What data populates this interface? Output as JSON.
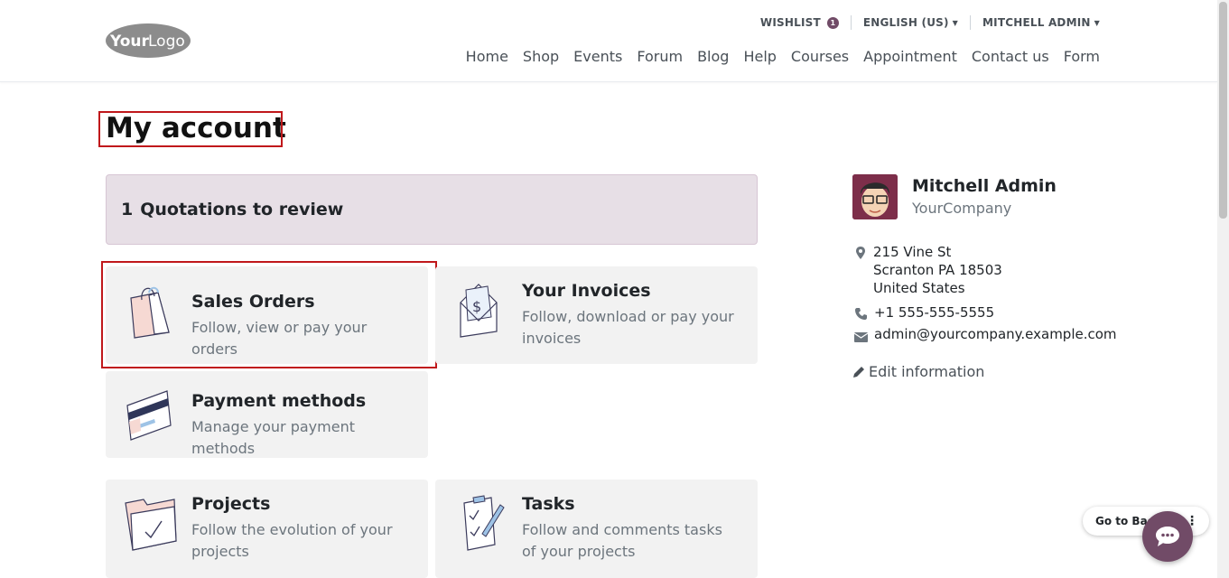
{
  "header": {
    "logo_alt": "Your Logo",
    "wishlist_label": "WISHLIST",
    "wishlist_count": "1",
    "language_label": "ENGLISH (US)",
    "user_label": "MITCHELL ADMIN",
    "nav": [
      "Home",
      "Shop",
      "Events",
      "Forum",
      "Blog",
      "Help",
      "Courses",
      "Appointment",
      "Contact us",
      "Form"
    ]
  },
  "page": {
    "title": "My account",
    "alert": {
      "count": "1",
      "label": "Quotations to review"
    }
  },
  "cards": {
    "sales_orders": {
      "title": "Sales Orders",
      "desc": "Follow, view or pay your orders"
    },
    "invoices": {
      "title": "Your Invoices",
      "desc": "Follow, download or pay your invoices"
    },
    "payment_methods": {
      "title": "Payment methods",
      "desc": "Manage your payment methods"
    },
    "projects": {
      "title": "Projects",
      "desc": "Follow the evolution of your projects"
    },
    "tasks": {
      "title": "Tasks",
      "desc": "Follow and comments tasks of your projects"
    }
  },
  "profile": {
    "name": "Mitchell Admin",
    "company": "YourCompany",
    "address_line1": "215 Vine St",
    "address_line2": "Scranton PA 18503",
    "address_line3": "United States",
    "phone": "+1 555-555-5555",
    "email": "admin@yourcompany.example.com",
    "edit_label": "Edit information"
  },
  "floating": {
    "go_back_label": "Go to Back",
    "dots": "⋮"
  },
  "icons": {
    "logo": "logo-icon",
    "map": "map-marker-icon",
    "phone": "phone-icon",
    "email": "envelope-icon",
    "edit": "pencil-icon",
    "chat": "chat-bubble-icon"
  },
  "colors": {
    "brand": "#714b67",
    "alert_bg": "#e7dfe6",
    "card_bg": "#f2f2f2",
    "highlight": "#c0181b"
  }
}
